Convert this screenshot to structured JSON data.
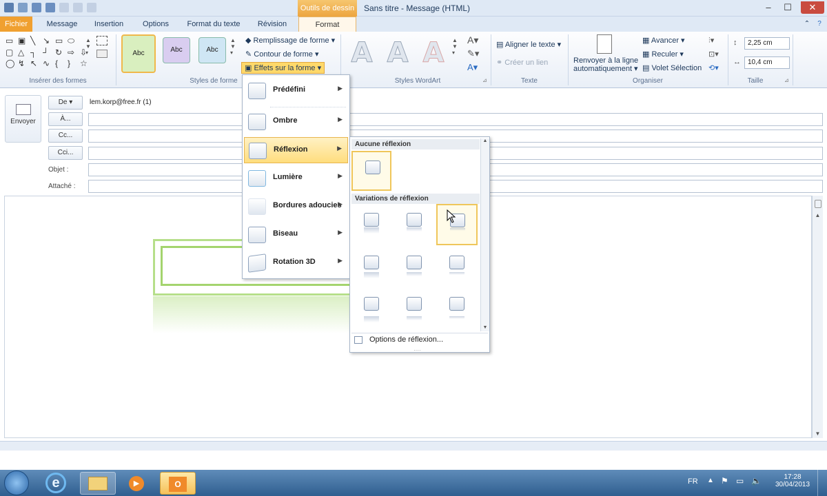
{
  "titlebar": {
    "context_tab": "Outils de dessin",
    "title": "Sans titre - Message (HTML)"
  },
  "tabs": [
    "Fichier",
    "Message",
    "Insertion",
    "Options",
    "Format du texte",
    "Révision",
    "Format"
  ],
  "ribbon": {
    "groups": {
      "insert_shapes": "Insérer des formes",
      "shape_styles": "Styles de forme",
      "wordart": "Styles WordArt",
      "text": "Texte",
      "arrange": "Organiser",
      "size": "Taille"
    },
    "style_sample": "Abc",
    "fill": "Remplissage de forme",
    "outline": "Contour de forme",
    "effects": "Effets sur la forme",
    "align_text": "Aligner le texte",
    "create_link": "Créer un lien",
    "wrap_line1": "Renvoyer à la ligne",
    "wrap_line2": "automatiquement",
    "bring_forward": "Avancer",
    "send_back": "Reculer",
    "selection_pane": "Volet Sélection",
    "height": "2,25 cm",
    "width": "10,4 cm"
  },
  "compose": {
    "send": "Envoyer",
    "from_btn": "De",
    "from_value": "lem.korp@free.fr (1)",
    "to_btn": "À...",
    "cc_btn": "Cc...",
    "bcc_btn": "Cci...",
    "subject": "Objet :",
    "attached": "Attaché :"
  },
  "effects_menu": {
    "items": [
      "Prédéfini",
      "Ombre",
      "Réflexion",
      "Lumière",
      "Bordures adoucies",
      "Biseau",
      "Rotation 3D"
    ]
  },
  "reflection_panel": {
    "no_reflection": "Aucune réflexion",
    "variations": "Variations de réflexion",
    "options": "Options de réflexion..."
  },
  "taskbar": {
    "lang": "FR",
    "time": "17:28",
    "date": "30/04/2013"
  },
  "colors": {
    "accent": "#f0a030",
    "shape_green": "#a4d46e"
  }
}
